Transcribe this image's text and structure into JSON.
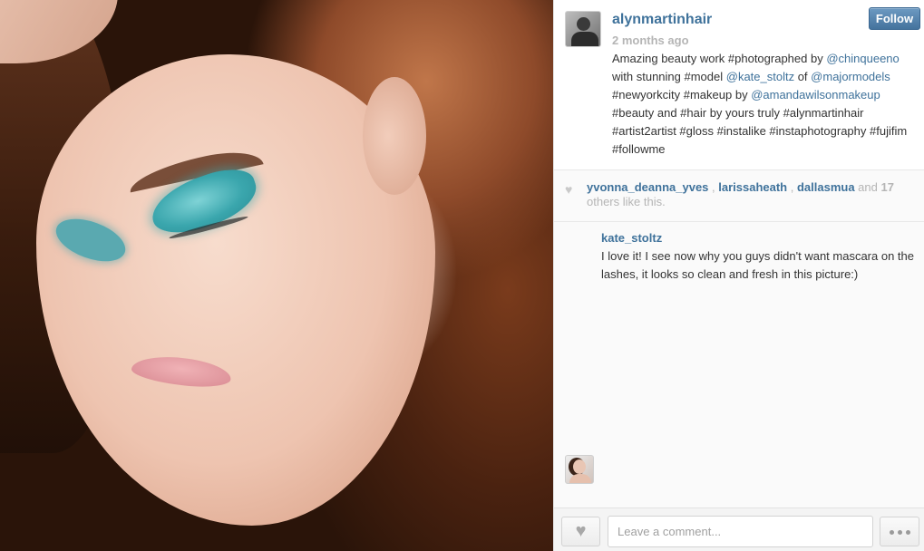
{
  "post": {
    "username": "alynmartinhair",
    "time_ago": "2 months ago",
    "follow_label": "Follow",
    "caption": {
      "t1": "Amazing beauty work #photographed by ",
      "m1": "@chinqueeno",
      "t2": " with stunning #model ",
      "m2": "@kate_stoltz",
      "t3": " of ",
      "m3": "@majormodels",
      "t4": " #newyorkcity #makeup by ",
      "m4": "@amandawilsonmakeup",
      "t5": " #beauty and #hair by yours truly #alynmartinhair #artist2artist #gloss #instalike #instaphotography #fujifim #followme"
    }
  },
  "likes": {
    "likers": [
      "yvonna_deanna_yves",
      "larissaheath",
      "dallasmua"
    ],
    "sep": " , ",
    "and_text": " and ",
    "count": "17",
    "suffix": " others like this."
  },
  "comments": [
    {
      "user": "kate_stoltz",
      "text": "I love it! I see now why you guys didn't want mascara on the lashes, it looks so clean and fresh in this picture:)"
    }
  ],
  "footer": {
    "comment_placeholder": "Leave a comment..."
  },
  "icons": {
    "like": "heart-icon",
    "more": "more-options-icon"
  },
  "colors": {
    "link": "#3f729b",
    "follow_button": "#517fa4",
    "muted": "#b5b5b5"
  }
}
